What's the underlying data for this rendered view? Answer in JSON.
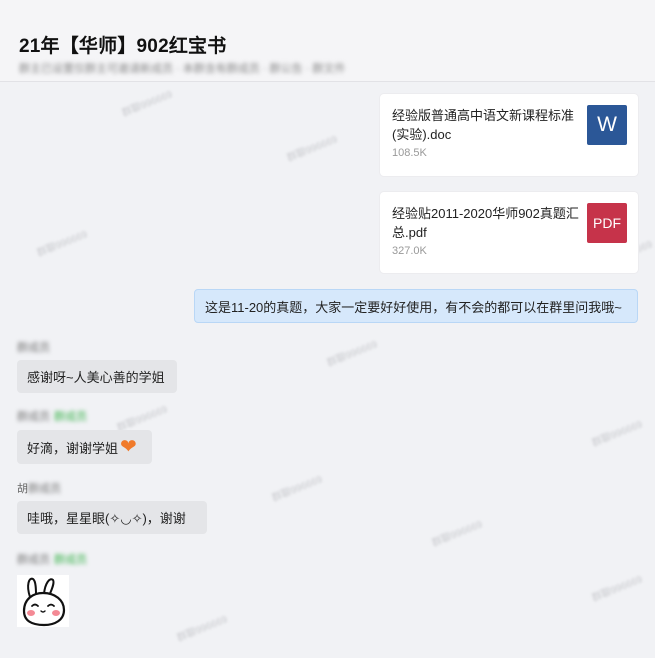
{
  "header": {
    "title": "21年【华师】902红宝书",
    "subtitle": "群主已设置仅群主可邀请新成员 · 本群含有群成员 · 群公告 · 群文件"
  },
  "files": [
    {
      "name": "经验版普通高中语文新课程标准(实验).doc",
      "size": "108.5K",
      "icon_label": "W",
      "icon": "word-icon",
      "color": "#2b5797"
    },
    {
      "name": "经验贴2011-2020华师902真题汇总.pdf",
      "size": "327.0K",
      "icon_label": "PDF",
      "icon": "pdf-icon",
      "color": "#c6334a"
    }
  ],
  "messages": {
    "mine": "这是11-20的真题，大家一定要好好使用，有不会的都可以在群里问我哦~",
    "reply1": {
      "sender": "群成员",
      "text": "感谢呀~人美心善的学姐"
    },
    "reply2": {
      "sender": "群成员",
      "badge": "群成员",
      "text": "好滴，谢谢学姐",
      "emoji": "heart-icon"
    },
    "reply3": {
      "sender_visible": "胡",
      "sender": "群成员",
      "text": "哇哦，星星眼(✧◡✧)，谢谢"
    },
    "reply4": {
      "sender": "群成员",
      "badge": "群成员",
      "sticker": "bunny-sticker"
    }
  },
  "watermark": "群聊996669"
}
